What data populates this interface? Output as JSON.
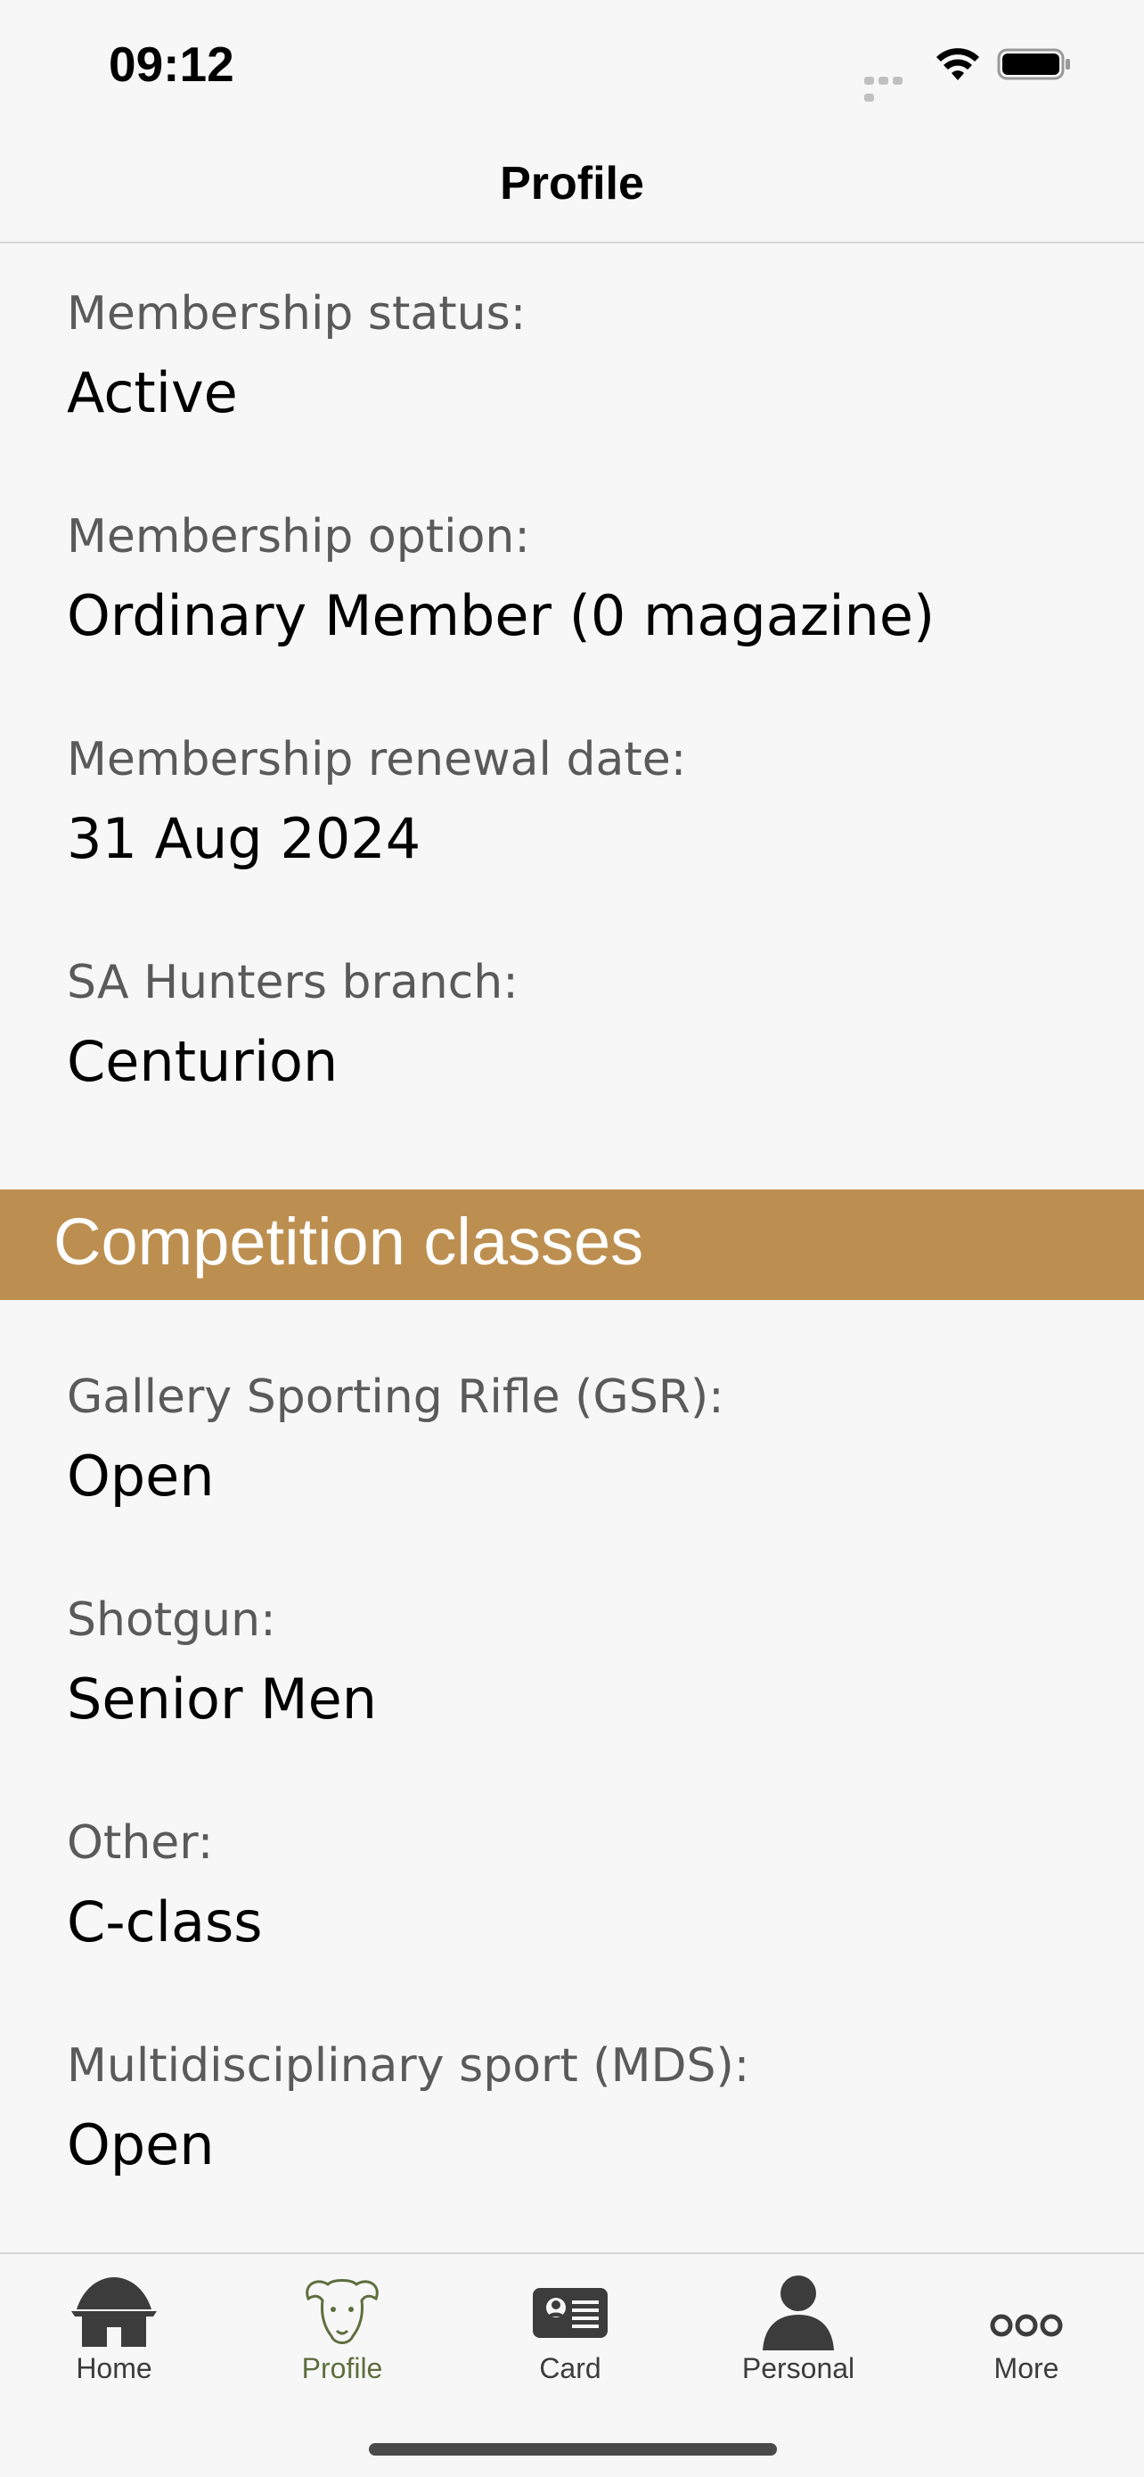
{
  "status_bar": {
    "time": "09:12"
  },
  "nav": {
    "title": "Profile"
  },
  "membership": [
    {
      "label": "Membership status:",
      "value": "Active"
    },
    {
      "label": "Membership option:",
      "value": "Ordinary Member (0 magazine)"
    },
    {
      "label": "Membership renewal date:",
      "value": "31 Aug 2024"
    },
    {
      "label": "SA Hunters branch:",
      "value": "Centurion"
    }
  ],
  "competition": {
    "title": "Competition classes",
    "items": [
      {
        "label": "Gallery Sporting Rifle (GSR):",
        "value": "Open"
      },
      {
        "label": "Shotgun:",
        "value": "Senior Men"
      },
      {
        "label": "Other:",
        "value": "C-class"
      },
      {
        "label": "Multidisciplinary sport (MDS):",
        "value": "Open"
      }
    ]
  },
  "tabs": [
    {
      "label": "Home",
      "icon": "hut-icon"
    },
    {
      "label": "Profile",
      "icon": "buffalo-icon",
      "active": true
    },
    {
      "label": "Card",
      "icon": "id-card-icon"
    },
    {
      "label": "Personal",
      "icon": "person-icon"
    },
    {
      "label": "More",
      "icon": "more-dots-icon"
    }
  ],
  "colors": {
    "accent": "#bc8f50",
    "active_tab": "#5e6e3e",
    "background": "#f7f7f7"
  }
}
